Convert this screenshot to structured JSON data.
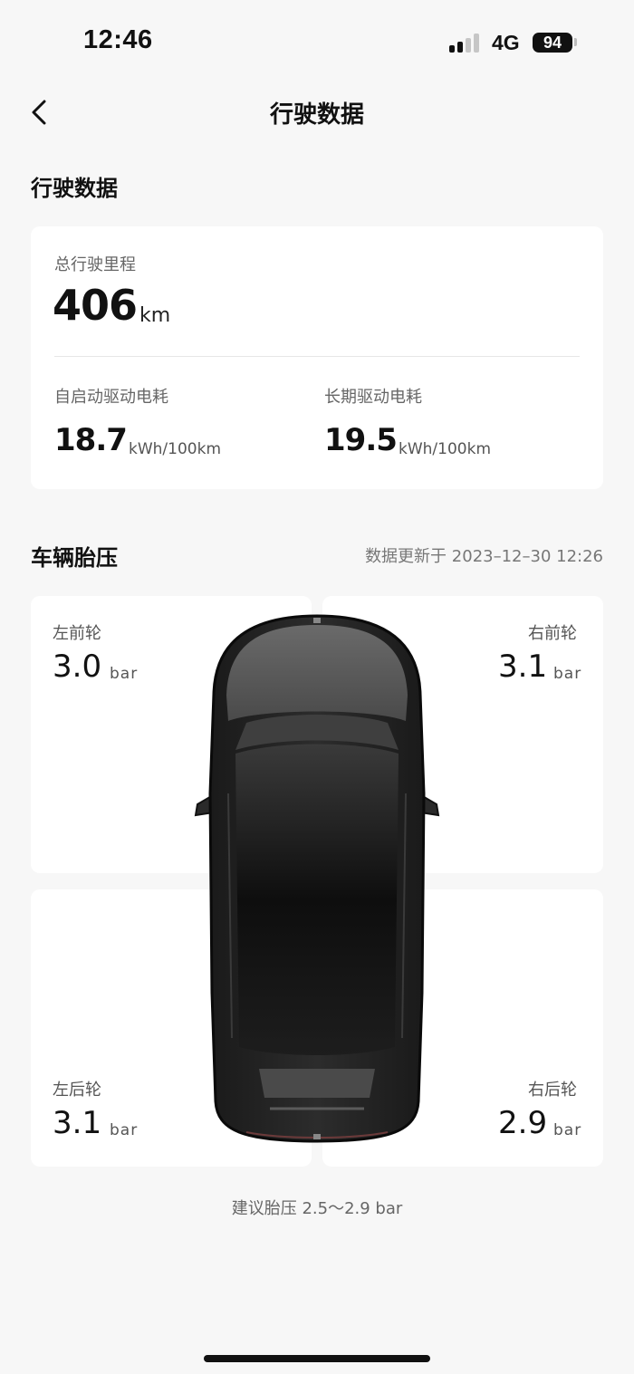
{
  "status_bar": {
    "time": "12:46",
    "network": "4G",
    "battery": "94"
  },
  "nav": {
    "title": "行驶数据"
  },
  "driving": {
    "section_title": "行驶数据",
    "total_mileage_label": "总行驶里程",
    "total_mileage_value": "406",
    "total_mileage_unit": "km",
    "since_start_label": "自启动驱动电耗",
    "since_start_value": "18.7",
    "long_term_label": "长期驱动电耗",
    "long_term_value": "19.5",
    "consumption_unit": "kWh/100km"
  },
  "tires": {
    "section_title": "车辆胎压",
    "update_time": "数据更新于 2023–12–30 12:26",
    "unit": "bar",
    "front_left": {
      "label": "左前轮",
      "value": "3.0"
    },
    "front_right": {
      "label": "右前轮",
      "value": "3.1"
    },
    "rear_left": {
      "label": "左后轮",
      "value": "3.1"
    },
    "rear_right": {
      "label": "右后轮",
      "value": "2.9"
    },
    "recommendation": "建议胎压 2.5～2.9 bar"
  },
  "icons": {
    "back": "chevron-left-icon",
    "signal": "cellular-signal-icon",
    "battery": "battery-icon"
  }
}
